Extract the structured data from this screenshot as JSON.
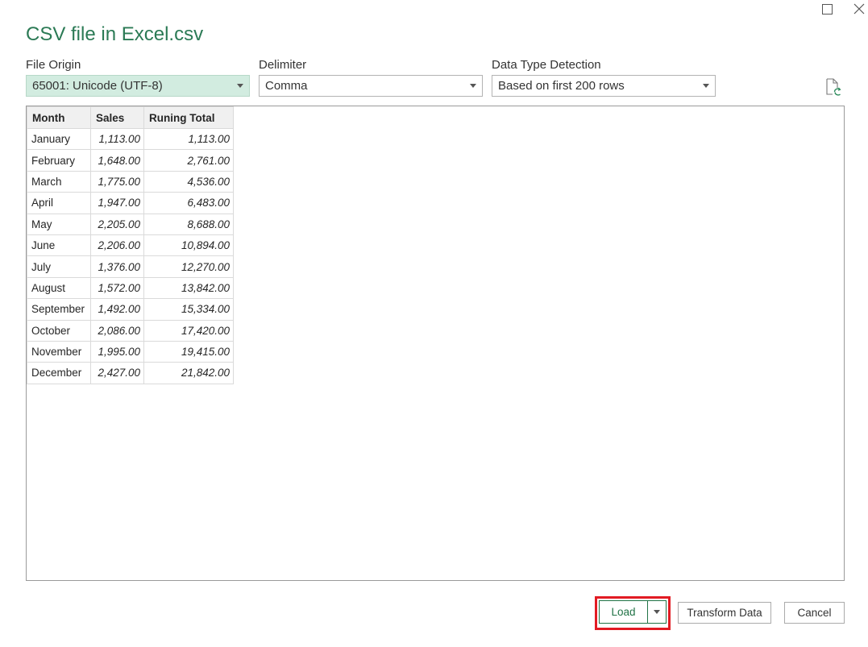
{
  "dialog": {
    "title": "CSV file in Excel.csv"
  },
  "options": {
    "file_origin": {
      "label": "File Origin",
      "value": "65001: Unicode (UTF-8)"
    },
    "delimiter": {
      "label": "Delimiter",
      "value": "Comma"
    },
    "data_type_detection": {
      "label": "Data Type Detection",
      "value": "Based on first 200 rows"
    }
  },
  "table": {
    "headers": [
      "Month",
      "Sales",
      "Runing Total"
    ],
    "rows": [
      [
        "January",
        "1,113.00",
        "1,113.00"
      ],
      [
        "February",
        "1,648.00",
        "2,761.00"
      ],
      [
        "March",
        "1,775.00",
        "4,536.00"
      ],
      [
        "April",
        "1,947.00",
        "6,483.00"
      ],
      [
        "May",
        "2,205.00",
        "8,688.00"
      ],
      [
        "June",
        "2,206.00",
        "10,894.00"
      ],
      [
        "July",
        "1,376.00",
        "12,270.00"
      ],
      [
        "August",
        "1,572.00",
        "13,842.00"
      ],
      [
        "September",
        "1,492.00",
        "15,334.00"
      ],
      [
        "October",
        "2,086.00",
        "17,420.00"
      ],
      [
        "November",
        "1,995.00",
        "19,415.00"
      ],
      [
        "December",
        "2,427.00",
        "21,842.00"
      ]
    ]
  },
  "buttons": {
    "load": "Load",
    "transform": "Transform Data",
    "cancel": "Cancel"
  },
  "icons": {
    "maximize": "maximize-icon",
    "close": "close-icon",
    "refresh": "refresh-file-icon",
    "dropdown": "chevron-down-icon"
  },
  "colors": {
    "title": "#2b7a55",
    "selected_dropdown_bg": "#d2ece0",
    "accent": "#217346",
    "highlight": "#e21b23"
  }
}
